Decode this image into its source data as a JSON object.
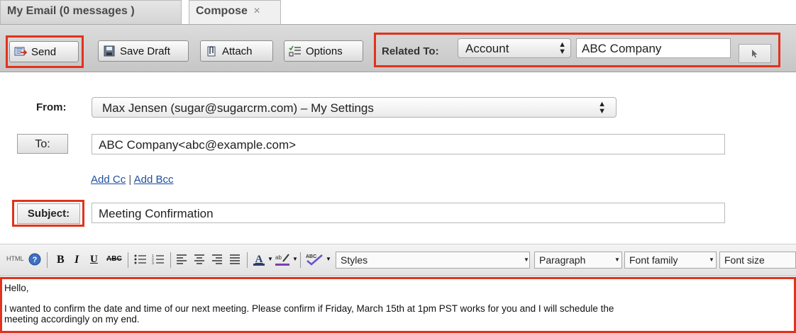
{
  "tabs": [
    {
      "label": "My Email (0 messages )"
    },
    {
      "label": "Compose",
      "close": "×"
    }
  ],
  "toolbar": {
    "send_label": "Send",
    "save_draft_label": "Save Draft",
    "attach_label": "Attach",
    "options_label": "Options",
    "related_to_label": "Related To:",
    "related_type": "Account",
    "related_name": "ABC Company"
  },
  "form": {
    "from_label": "From:",
    "from_value": "Max Jensen (sugar@sugarcrm.com) – My Settings",
    "to_label": "To:",
    "to_value": "ABC Company<abc@example.com>",
    "add_cc": "Add Cc",
    "link_separator": "|",
    "add_bcc": "Add Bcc",
    "subject_label": "Subject:",
    "subject_value": "Meeting Confirmation"
  },
  "editor": {
    "html_label": "HTML",
    "styles": "Styles",
    "paragraph": "Paragraph",
    "font_family": "Font family",
    "font_size": "Font size",
    "body_line1": "Hello,",
    "body_line2": "I wanted to confirm the date and time of our next meeting. Please confirm if Friday, March 15th at 1pm PST works for you and I will schedule the",
    "body_line3": "meeting accordingly on my end."
  },
  "colors": {
    "highlight": "#e2321c",
    "link": "#1f4e9e"
  }
}
